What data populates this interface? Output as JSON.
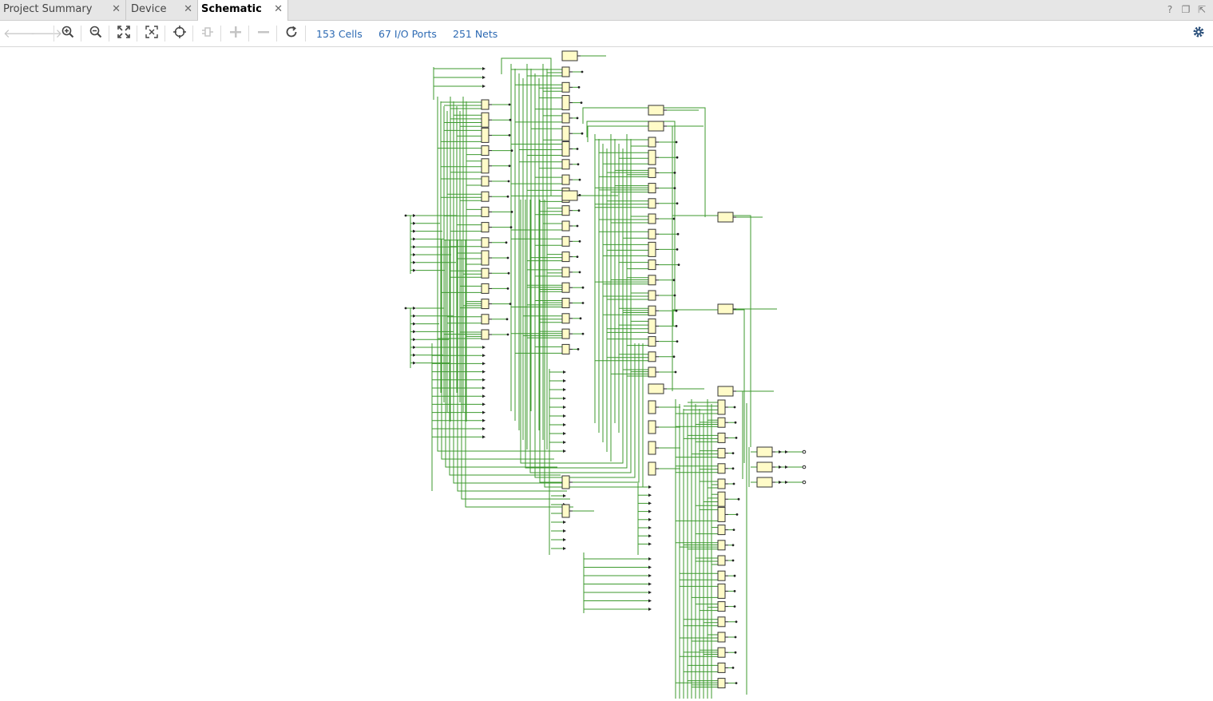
{
  "tabs": [
    {
      "label": "Project Summary",
      "active": false
    },
    {
      "label": "Device",
      "active": false
    },
    {
      "label": "Schematic",
      "active": true
    }
  ],
  "window_controls": [
    "help-icon",
    "restore-icon",
    "maximize-icon"
  ],
  "toolbar": {
    "buttons": [
      "back-icon",
      "forward-icon",
      "zoom-in-icon",
      "zoom-out-icon",
      "zoom-fit-icon",
      "fit-selection-icon",
      "crosshair-icon",
      "ipo-icon",
      "expand-icon",
      "collapse-icon",
      "refresh-icon"
    ],
    "cells": "153 Cells",
    "io_ports": "67 I/O Ports",
    "nets": "251 Nets",
    "settings_icon": "gear-icon"
  },
  "colors": {
    "wire": "#3c9a2e",
    "cell_fill": "#fffbc8",
    "cell_border": "#333333",
    "link": "#2d6ab3"
  }
}
